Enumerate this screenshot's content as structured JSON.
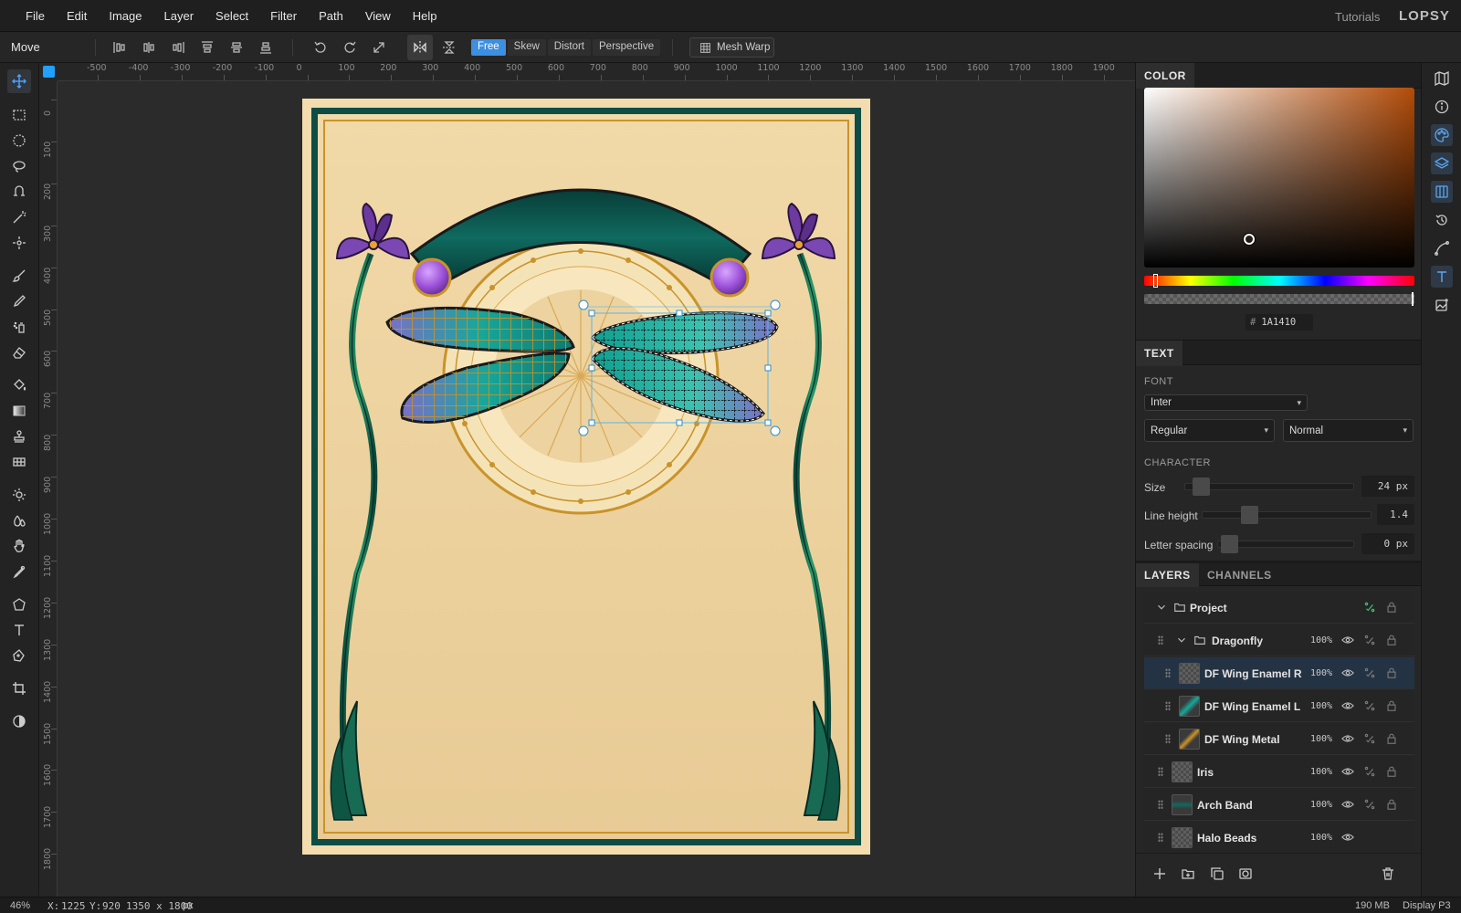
{
  "menu": {
    "items": [
      "File",
      "Edit",
      "Image",
      "Layer",
      "Select",
      "Filter",
      "Path",
      "View",
      "Help"
    ],
    "tutorials": "Tutorials",
    "logo": "LOPSY"
  },
  "options": {
    "tool_name": "Move",
    "modes": [
      "Free",
      "Skew",
      "Distort",
      "Perspective"
    ],
    "active_mode": "Free",
    "mesh_warp": "Mesh Warp"
  },
  "ruler": {
    "h_ticks": [
      "-500",
      "-400",
      "-300",
      "-200",
      "-100",
      "0",
      "100",
      "200",
      "300",
      "400",
      "500",
      "600",
      "700",
      "800",
      "900",
      "1000",
      "1100",
      "1200",
      "1300",
      "1400",
      "1500",
      "1600",
      "1700",
      "1800",
      "1900"
    ],
    "v_ticks": [
      "0",
      "100",
      "200",
      "300",
      "400",
      "500",
      "600",
      "700",
      "800",
      "900",
      "1000",
      "1100",
      "1200",
      "1300",
      "1400",
      "1500",
      "1600",
      "1700",
      "1800"
    ]
  },
  "color_panel": {
    "tab": "COLOR",
    "hex_hash": "#",
    "hex": "1A1410",
    "hue_color": "#b34c09"
  },
  "text_panel": {
    "tab": "TEXT",
    "font_label": "FONT",
    "font": "Inter",
    "weight": "Regular",
    "style": "Normal",
    "character_label": "CHARACTER",
    "size_label": "Size",
    "size_value": "24 px",
    "line_height_label": "Line height",
    "line_height_value": "1.4",
    "letter_spacing_label": "Letter spacing",
    "letter_spacing_value": "0 px"
  },
  "layers_panel": {
    "tabs": [
      "LAYERS",
      "CHANNELS"
    ],
    "rows": [
      {
        "name": "Project",
        "opacity": ""
      },
      {
        "name": "Dragonfly",
        "opacity": "100%"
      },
      {
        "name": "DF Wing Enamel R",
        "opacity": "100%"
      },
      {
        "name": "DF Wing Enamel L",
        "opacity": "100%"
      },
      {
        "name": "DF Wing Metal",
        "opacity": "100%"
      },
      {
        "name": "Iris",
        "opacity": "100%"
      },
      {
        "name": "Arch Band",
        "opacity": "100%"
      },
      {
        "name": "Halo Beads",
        "opacity": "100%"
      }
    ]
  },
  "status": {
    "zoom": "46%",
    "x_label": "X:",
    "x": "1225",
    "y_label": "Y:",
    "y": "920",
    "doc_size": "1350 x 1800",
    "doc_unit": "px",
    "memory": "190 MB",
    "color_profile": "Display P3"
  },
  "colors": {
    "accent": "#3d8fe0",
    "frame_teal": "#0d4d45",
    "parchment": "#f1d9a8",
    "gold": "#c9932a",
    "iris_purple": "#6c3aa0"
  }
}
